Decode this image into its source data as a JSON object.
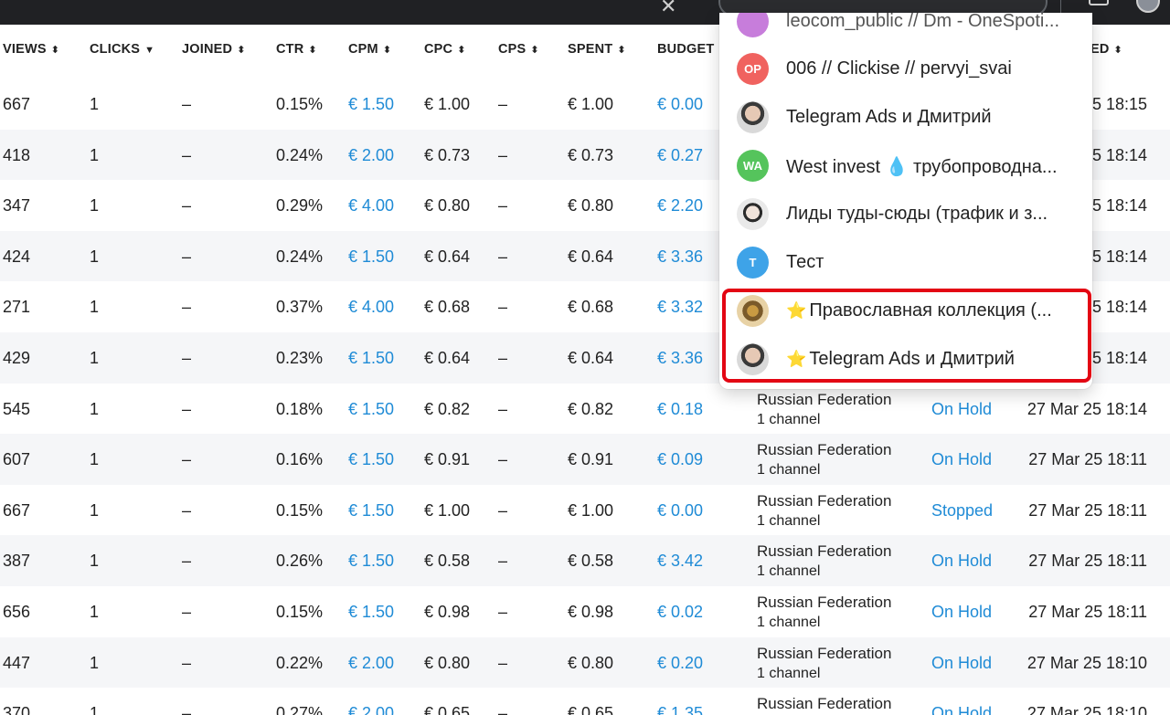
{
  "browser": {
    "close_glyph": "✕"
  },
  "table": {
    "headers": [
      {
        "label": "VIEWS",
        "sort": "⬍"
      },
      {
        "label": "CLICKS",
        "sort": "▼"
      },
      {
        "label": "JOINED",
        "sort": "⬍"
      },
      {
        "label": "CTR",
        "sort": "⬍"
      },
      {
        "label": "CPM",
        "sort": "⬍"
      },
      {
        "label": "CPC",
        "sort": "⬍"
      },
      {
        "label": "CPS",
        "sort": "⬍"
      },
      {
        "label": "SPENT",
        "sort": "⬍"
      },
      {
        "label": "BUDGET",
        "sort": ""
      },
      {
        "label": "ED",
        "sort": "⬍"
      }
    ],
    "rows": [
      {
        "views": "667",
        "clicks": "1",
        "joined": "–",
        "ctr": "0.15%",
        "cpm": "€ 1.50",
        "cpc": "€ 1.00",
        "cps": "–",
        "spent": "€ 1.00",
        "budget": "€ 0.00",
        "target": "",
        "target_sub": "",
        "status": "",
        "date": "5 18:15"
      },
      {
        "views": "418",
        "clicks": "1",
        "joined": "–",
        "ctr": "0.24%",
        "cpm": "€ 2.00",
        "cpc": "€ 0.73",
        "cps": "–",
        "spent": "€ 0.73",
        "budget": "€ 0.27",
        "target": "",
        "target_sub": "",
        "status": "",
        "date": "5 18:14"
      },
      {
        "views": "347",
        "clicks": "1",
        "joined": "–",
        "ctr": "0.29%",
        "cpm": "€ 4.00",
        "cpc": "€ 0.80",
        "cps": "–",
        "spent": "€ 0.80",
        "budget": "€ 2.20",
        "target": "",
        "target_sub": "",
        "status": "",
        "date": "5 18:14"
      },
      {
        "views": "424",
        "clicks": "1",
        "joined": "–",
        "ctr": "0.24%",
        "cpm": "€ 1.50",
        "cpc": "€ 0.64",
        "cps": "–",
        "spent": "€ 0.64",
        "budget": "€ 3.36",
        "target": "",
        "target_sub": "",
        "status": "",
        "date": "5 18:14"
      },
      {
        "views": "271",
        "clicks": "1",
        "joined": "–",
        "ctr": "0.37%",
        "cpm": "€ 4.00",
        "cpc": "€ 0.68",
        "cps": "–",
        "spent": "€ 0.68",
        "budget": "€ 3.32",
        "target": "",
        "target_sub": "",
        "status": "",
        "date": "5 18:14"
      },
      {
        "views": "429",
        "clicks": "1",
        "joined": "–",
        "ctr": "0.23%",
        "cpm": "€ 1.50",
        "cpc": "€ 0.64",
        "cps": "–",
        "spent": "€ 0.64",
        "budget": "€ 3.36",
        "target": "",
        "target_sub": "",
        "status": "",
        "date": "5 18:14"
      },
      {
        "views": "545",
        "clicks": "1",
        "joined": "–",
        "ctr": "0.18%",
        "cpm": "€ 1.50",
        "cpc": "€ 0.82",
        "cps": "–",
        "spent": "€ 0.82",
        "budget": "€ 0.18",
        "target": "Russian Federation",
        "target_sub": "1 channel",
        "status": "On Hold",
        "date": "27 Mar 25 18:14"
      },
      {
        "views": "607",
        "clicks": "1",
        "joined": "–",
        "ctr": "0.16%",
        "cpm": "€ 1.50",
        "cpc": "€ 0.91",
        "cps": "–",
        "spent": "€ 0.91",
        "budget": "€ 0.09",
        "target": "Russian Federation",
        "target_sub": "1 channel",
        "status": "On Hold",
        "date": "27 Mar 25 18:11"
      },
      {
        "views": "667",
        "clicks": "1",
        "joined": "–",
        "ctr": "0.15%",
        "cpm": "€ 1.50",
        "cpc": "€ 1.00",
        "cps": "–",
        "spent": "€ 1.00",
        "budget": "€ 0.00",
        "target": "Russian Federation",
        "target_sub": "1 channel",
        "status": "Stopped",
        "date": "27 Mar 25 18:11"
      },
      {
        "views": "387",
        "clicks": "1",
        "joined": "–",
        "ctr": "0.26%",
        "cpm": "€ 1.50",
        "cpc": "€ 0.58",
        "cps": "–",
        "spent": "€ 0.58",
        "budget": "€ 3.42",
        "target": "Russian Federation",
        "target_sub": "1 channel",
        "status": "On Hold",
        "date": "27 Mar 25 18:11"
      },
      {
        "views": "656",
        "clicks": "1",
        "joined": "–",
        "ctr": "0.15%",
        "cpm": "€ 1.50",
        "cpc": "€ 0.98",
        "cps": "–",
        "spent": "€ 0.98",
        "budget": "€ 0.02",
        "target": "Russian Federation",
        "target_sub": "1 channel",
        "status": "On Hold",
        "date": "27 Mar 25 18:11"
      },
      {
        "views": "447",
        "clicks": "1",
        "joined": "–",
        "ctr": "0.22%",
        "cpm": "€ 2.00",
        "cpc": "€ 0.80",
        "cps": "–",
        "spent": "€ 0.80",
        "budget": "€ 0.20",
        "target": "Russian Federation",
        "target_sub": "1 channel",
        "status": "On Hold",
        "date": "27 Mar 25 18:10"
      },
      {
        "views": "370",
        "clicks": "1",
        "joined": "–",
        "ctr": "0.27%",
        "cpm": "€ 2.00",
        "cpc": "€ 0.65",
        "cps": "–",
        "spent": "€ 0.65",
        "budget": "€ 1.35",
        "target": "Russian Federation",
        "target_sub": "",
        "status": "On Hold",
        "date": "27 Mar 25 18:10"
      }
    ]
  },
  "dropdown": {
    "partial_top_label": "leocom_public // Dm - OneSpoti...",
    "items": [
      {
        "avatar_text": "OP",
        "avatar_color": "#f0625f",
        "label": "006 // Clickise // pervyi_svai",
        "star": false,
        "photo": ""
      },
      {
        "avatar_text": "",
        "avatar_color": "",
        "label": "Telegram Ads и Дмитрий",
        "star": false,
        "photo": "person"
      },
      {
        "avatar_text": "WA",
        "avatar_color": "#55c45c",
        "label_before": "West invest ",
        "drop": "💧",
        "label": "трубопроводна...",
        "star": false,
        "photo": ""
      },
      {
        "avatar_text": "",
        "avatar_color": "",
        "label": "Лиды туды-сюды (трафик и з...",
        "star": false,
        "photo": "man"
      },
      {
        "avatar_text": "T",
        "avatar_color": "#3ea3e8",
        "label": "Тест",
        "star": false,
        "photo": ""
      },
      {
        "avatar_text": "",
        "avatar_color": "",
        "label": "Православная коллекция (...",
        "star": true,
        "star_glyph": "⭐",
        "photo": "icon"
      },
      {
        "avatar_text": "",
        "avatar_color": "",
        "label": "Telegram Ads и Дмитрий",
        "star": true,
        "star_glyph": "⭐",
        "photo": "person"
      }
    ]
  }
}
